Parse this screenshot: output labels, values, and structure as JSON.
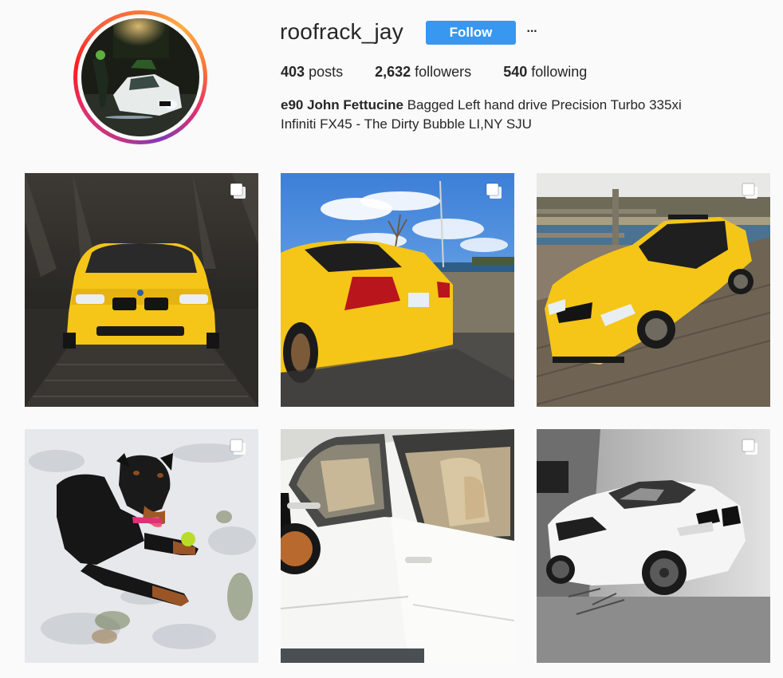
{
  "profile": {
    "username": "roofrack_jay",
    "follow_label": "Follow",
    "more_label": "···",
    "stats": {
      "posts_count": "403",
      "posts_label": "posts",
      "followers_count": "2,632",
      "followers_label": "followers",
      "following_count": "540",
      "following_label": "following"
    },
    "bio": {
      "name": "e90 John Fettucine",
      "line1": "Bagged Left hand drive Precision Turbo 335xi",
      "line2": "Infiniti FX45 - The Dirty Bubble LI,NY SJU"
    }
  },
  "posts": [
    {
      "subject": "yellow-bmw-front-dock",
      "multi": true
    },
    {
      "subject": "yellow-bmw-rear-sky",
      "multi": true
    },
    {
      "subject": "yellow-bmw-side-dock",
      "multi": true
    },
    {
      "subject": "rottweiler-snow",
      "multi": true
    },
    {
      "subject": "white-bmw-door-seats",
      "multi": false
    },
    {
      "subject": "white-bmw-garage",
      "multi": true
    }
  ],
  "colors": {
    "accent": "#3897f0",
    "text": "#262626",
    "background": "#fafafa",
    "car_yellow": "#f5c518"
  },
  "icons": {
    "multi_post": "multi-post-icon",
    "more": "more-options-icon"
  }
}
